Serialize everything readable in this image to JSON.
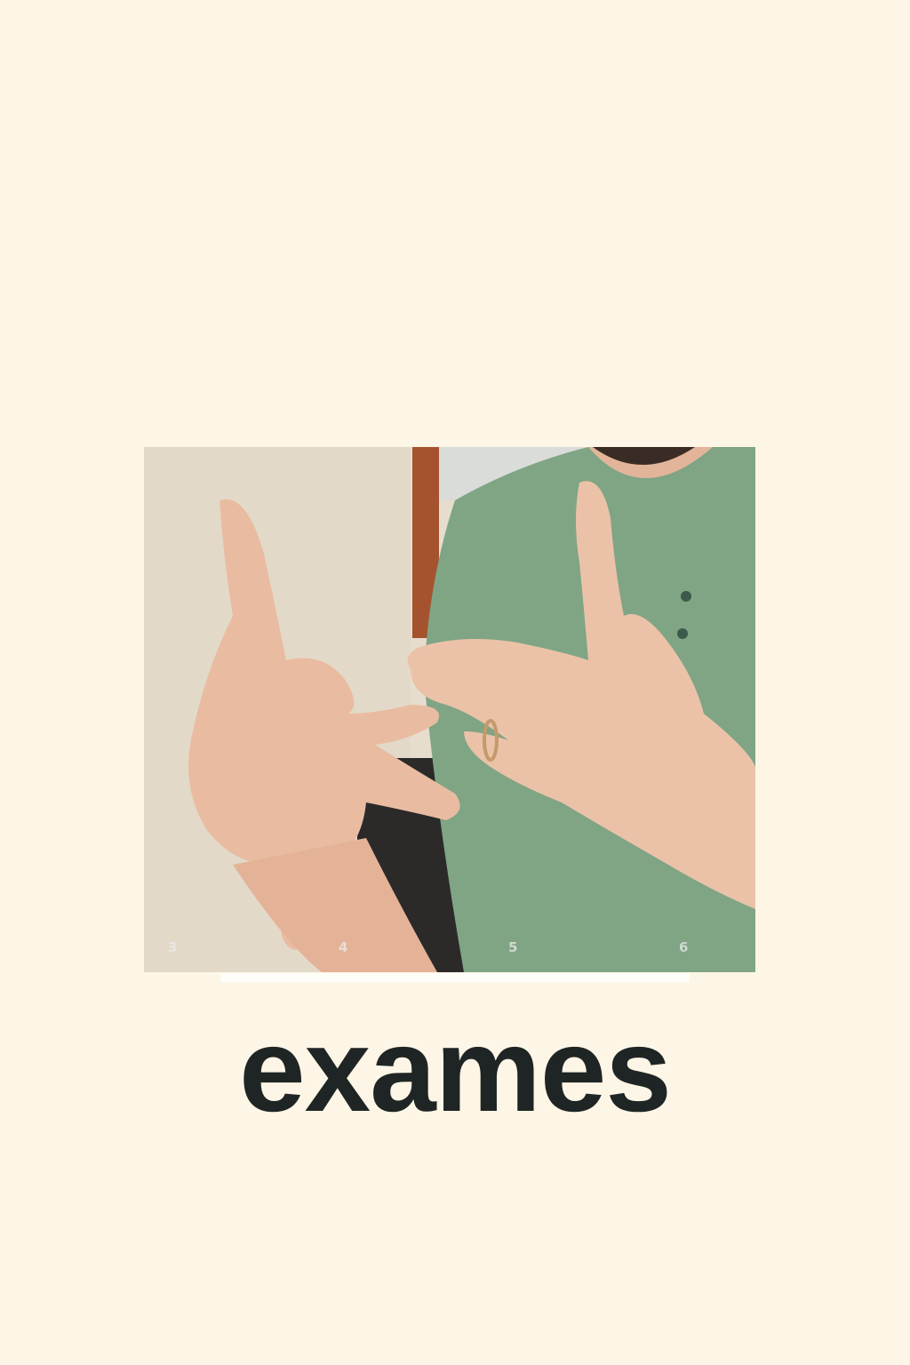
{
  "caption": {
    "word": "exames"
  },
  "video": {
    "frame_labels": [
      "3",
      "4",
      "5",
      "6"
    ]
  },
  "colors": {
    "background": "#fdf6e6",
    "caption_text": "#1f2524",
    "shirt": "#7fa585",
    "skin": "#e9bca1"
  }
}
